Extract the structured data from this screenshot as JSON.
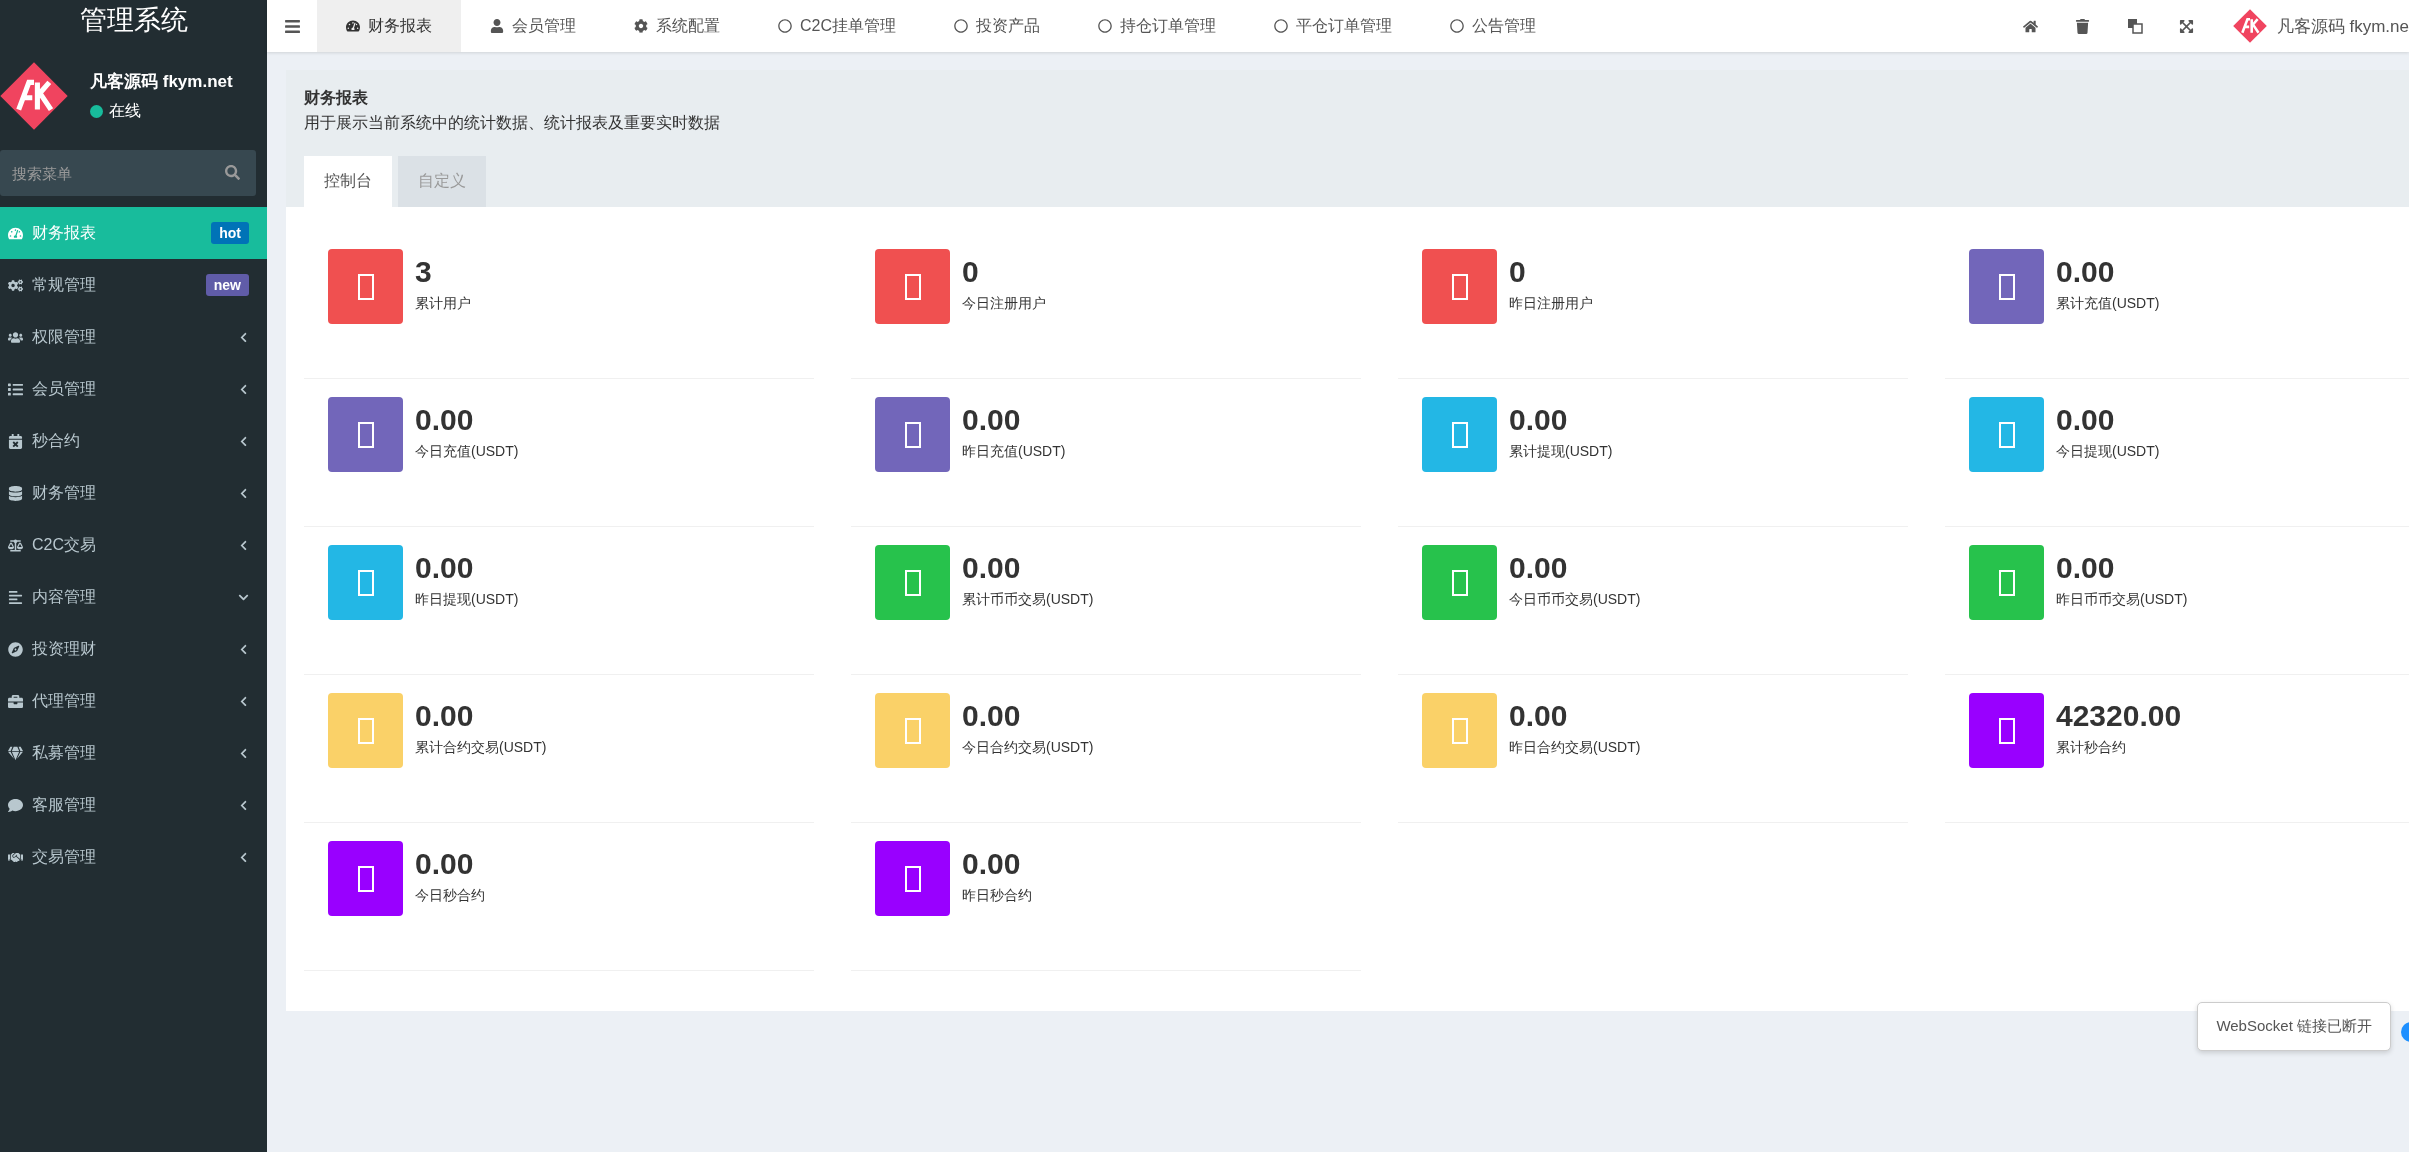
{
  "sidebar": {
    "title": "管理系统",
    "user": {
      "name": "凡客源码 fkym.net",
      "status": "在线"
    },
    "search": {
      "placeholder": "搜索菜单"
    },
    "items": [
      {
        "label": "财务报表",
        "kind": "badge",
        "badge": "hot",
        "color": "#0073b7",
        "selected": true
      },
      {
        "label": "常规管理",
        "kind": "badge",
        "badge": "new",
        "color": "#605ca8",
        "selected": false
      },
      {
        "label": "权限管理",
        "kind": "group",
        "expanded": false,
        "selected": false
      },
      {
        "label": "会员管理",
        "kind": "group",
        "expanded": false,
        "selected": false
      },
      {
        "label": "秒合约",
        "kind": "group",
        "expanded": false,
        "selected": false
      },
      {
        "label": "财务管理",
        "kind": "group",
        "expanded": false,
        "selected": false
      },
      {
        "label": "C2C交易",
        "kind": "group",
        "expanded": false,
        "selected": false
      },
      {
        "label": "内容管理",
        "kind": "group",
        "expanded": true,
        "selected": false
      },
      {
        "label": "投资理财",
        "kind": "group",
        "expanded": false,
        "selected": false
      },
      {
        "label": "代理管理",
        "kind": "group",
        "expanded": false,
        "selected": false
      },
      {
        "label": "私募管理",
        "kind": "group",
        "expanded": false,
        "selected": false
      },
      {
        "label": "客服管理",
        "kind": "group",
        "expanded": false,
        "selected": false
      },
      {
        "label": "交易管理",
        "kind": "group",
        "expanded": false,
        "selected": false
      }
    ]
  },
  "topbar": {
    "tabs": [
      {
        "label": "财务报表",
        "selected": true
      },
      {
        "label": "会员管理",
        "selected": false
      },
      {
        "label": "系统配置",
        "selected": false
      },
      {
        "label": "C2C挂单管理",
        "selected": false
      },
      {
        "label": "投资产品",
        "selected": false
      },
      {
        "label": "持仓订单管理",
        "selected": false
      },
      {
        "label": "平仓订单管理",
        "selected": false
      },
      {
        "label": "公告管理",
        "selected": false
      }
    ],
    "user": "凡客源码 fkym.ne"
  },
  "panel": {
    "title": "财务报表",
    "description": "用于展示当前系统中的统计数据、统计报表及重要实时数据",
    "tabs": [
      {
        "label": "控制台",
        "selected": true
      },
      {
        "label": "自定义",
        "selected": false
      }
    ],
    "cards": [
      {
        "value": "3",
        "label": "累计用户",
        "color": "#f05050"
      },
      {
        "value": "0",
        "label": "今日注册用户",
        "color": "#f05050"
      },
      {
        "value": "0",
        "label": "昨日注册用户",
        "color": "#f05050"
      },
      {
        "value": "0.00",
        "label": "累计充值(USDT)",
        "color": "#7266ba"
      },
      {
        "value": "0.00",
        "label": "今日充值(USDT)",
        "color": "#7266ba"
      },
      {
        "value": "0.00",
        "label": "昨日充值(USDT)",
        "color": "#7266ba"
      },
      {
        "value": "0.00",
        "label": "累计提现(USDT)",
        "color": "#23b7e5"
      },
      {
        "value": "0.00",
        "label": "今日提现(USDT)",
        "color": "#23b7e5"
      },
      {
        "value": "0.00",
        "label": "昨日提现(USDT)",
        "color": "#23b7e5"
      },
      {
        "value": "0.00",
        "label": "累计币币交易(USDT)",
        "color": "#27c24c"
      },
      {
        "value": "0.00",
        "label": "今日币币交易(USDT)",
        "color": "#27c24c"
      },
      {
        "value": "0.00",
        "label": "昨日币币交易(USDT)",
        "color": "#27c24c"
      },
      {
        "value": "0.00",
        "label": "累计合约交易(USDT)",
        "color": "#fad168"
      },
      {
        "value": "0.00",
        "label": "今日合约交易(USDT)",
        "color": "#fad168"
      },
      {
        "value": "0.00",
        "label": "昨日合约交易(USDT)",
        "color": "#fad168"
      },
      {
        "value": "42320.00",
        "label": "累计秒合约",
        "color": "#9900ff"
      },
      {
        "value": "0.00",
        "label": "今日秒合约",
        "color": "#9900ff"
      },
      {
        "value": "0.00",
        "label": "昨日秒合约",
        "color": "#9900ff"
      }
    ]
  },
  "toast": "WebSocket 链接已断开"
}
